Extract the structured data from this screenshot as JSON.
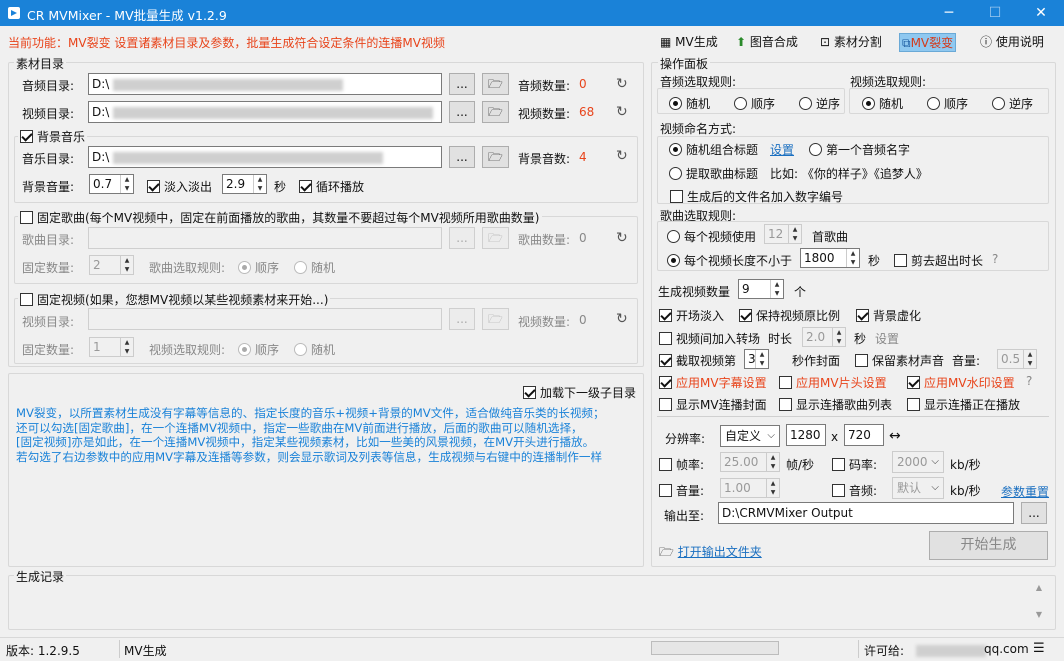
{
  "window": {
    "title": "CR MVMixer - MV批量生成 v1.2.9",
    "min": "─",
    "max": "☐",
    "close": "✕"
  },
  "hint": "当前功能：MV裂变  设置诸素材目录及参数，批量生成符合设定条件的连播MV视频",
  "tabs": [
    {
      "label": "MV生成",
      "icon": "film-icon"
    },
    {
      "label": "图音合成",
      "icon": "image-up-icon"
    },
    {
      "label": "素材分割",
      "icon": "split-icon"
    },
    {
      "label": "MV裂变",
      "icon": "clone-icon"
    },
    {
      "label": "使用说明",
      "icon": "help-icon"
    }
  ],
  "material": {
    "title": "素材目录",
    "audio_dir_label": "音频目录:",
    "audio_dir_value": "D:\\",
    "audio_count_label": "音频数量:",
    "audio_count": "0",
    "video_dir_label": "视频目录:",
    "video_dir_value": "D:\\",
    "video_count_label": "视频数量:",
    "video_count": "68",
    "browse": "...",
    "bgm_check": "背景音乐",
    "music_dir_label": "音乐目录:",
    "music_dir_value": "D:\\",
    "bgm_count_label": "背景音数:",
    "bgm_count": "4",
    "bgm_volume_label": "背景音量:",
    "bgm_volume": "0.7",
    "fade_label": "淡入淡出",
    "fade_value": "2.9",
    "sec": "秒",
    "loop_label": "循环播放",
    "fixed_song_check": "固定歌曲(每个MV视频中，固定在前面播放的歌曲，其数量不要超过每个MV视频所用歌曲数量)",
    "song_dir_label": "歌曲目录:",
    "song_count_label": "歌曲数量:",
    "song_count": "0",
    "fixed_count_label": "固定数量:",
    "fixed_song_count": "2",
    "song_rule_label": "歌曲选取规则:",
    "order": "顺序",
    "random": "随机",
    "fixed_video_check": "固定视频(如果，您想MV视频以某些视频素材来开始...)",
    "fv_dir_label": "视频目录:",
    "fv_count_label": "视频数量:",
    "fv_count": "0",
    "fv_fixed_label": "固定数量:",
    "fv_fixed_count": "1",
    "fv_rule_label": "视频选取规则:",
    "load_sub": "加载下一级子目录"
  },
  "description": [
    "MV裂变，以所置素材生成没有字幕等信息的、指定长度的音乐+视频+背景的MV文件，适合做纯音乐类的长视频；",
    "还可以勾选[固定歌曲]，在一个连播MV视频中，指定一些歌曲在MV前面进行播放，后面的歌曲可以随机选择，",
    "[固定视频]亦是如此，在一个连播MV视频中，指定某些视频素材，比如一些美的风景视频，在MV开头进行播放。",
    "若勾选了右边参数中的应用MV字幕及连播等参数，则会显示歌词及列表等信息，生成视频与右键中的连播制作一样"
  ],
  "ops": {
    "title": "操作面板",
    "audio_rule_label": "音频选取规则:",
    "video_rule_label": "视频选取规则:",
    "r_random": "随机",
    "r_order": "顺序",
    "r_reverse": "逆序",
    "naming_label": "视频命名方式:",
    "naming_combo": "随机组合标题",
    "naming_setting": "设置",
    "naming_first": "第一个音频名字",
    "naming_extract": "提取歌曲标题",
    "naming_example": "比如: 《你的样子》《追梦人》",
    "add_number": "生成后的文件名加入数字编号",
    "song_rule_label": "歌曲选取规则:",
    "per_video_use": "每个视频使用",
    "per_video_use_val": "12",
    "song_unit": "首歌曲",
    "per_video_len": "每个视频长度不小于",
    "per_video_len_val": "1800",
    "sec": "秒",
    "cut_over": "剪去超出时长",
    "q": "?",
    "gen_count_label": "生成视频数量",
    "gen_count": "9",
    "gen_unit": "个",
    "fade_in": "开场淡入",
    "keep_ratio": "保持视频原比例",
    "bg_blur": "背景虚化",
    "transition": "视频间加入转场",
    "duration_label": "时长",
    "duration_val": "2.0",
    "settings": "设置",
    "capture": "截取视频第",
    "capture_val": "3",
    "capture_tail": "秒作封面",
    "keep_sound": "保留素材声音",
    "volume_label": "音量:",
    "volume_val": "0.5",
    "apply_sub": "应用MV字幕设置",
    "apply_head": "应用MV片头设置",
    "apply_wm": "应用MV水印设置",
    "show_cover": "显示MV连播封面",
    "show_list": "显示连播歌曲列表",
    "show_playing": "显示连播正在播放",
    "res_label": "分辨率:",
    "res_mode": "自定义",
    "res_w": "1280",
    "res_x": "x",
    "res_h": "720",
    "swap": "↔",
    "fps_label": "帧率:",
    "fps_val": "25.00",
    "fps_unit": "帧/秒",
    "bitrate_label": "码率:",
    "bitrate_val": "2000",
    "bitrate_unit": "kb/秒",
    "vol_label": "音量:",
    "vol_val": "1.00",
    "afreq_label": "音频:",
    "afreq_val": "默认",
    "afreq_unit": "kb/秒",
    "reset": "参数重置",
    "output_label": "输出至:",
    "output_val": "D:\\CRMVMixer Output",
    "open_folder": "打开输出文件夹",
    "start": "开始生成"
  },
  "log": {
    "title": "生成记录"
  },
  "status": {
    "version": "版本:  1.2.9.5",
    "mode": "MV生成",
    "license": "许可给:",
    "license_tail": "qq.com"
  }
}
